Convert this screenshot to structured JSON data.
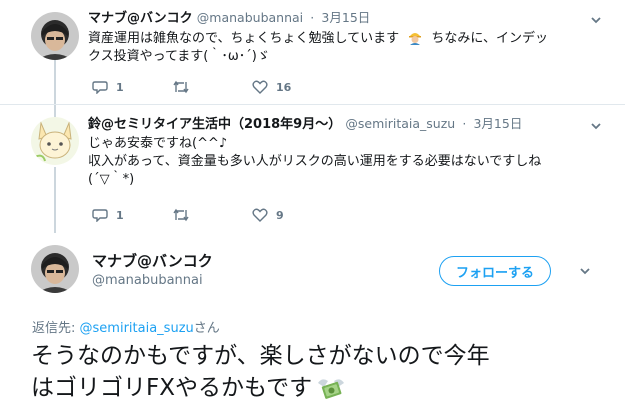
{
  "replies": [
    {
      "name": "マナブ@バンコク",
      "handle": "@manabubannai",
      "dot": "·",
      "date": "3月15日",
      "lines": [
        "資産運用は雑魚なので、ちょくちょく勉強しています",
        "ちなみに、インデッ",
        "クス投資やってます(｀･ω･´)ゞ"
      ],
      "reply_count": "1",
      "retweet_count": "",
      "like_count": "16"
    },
    {
      "name": "鈴@セミリタイア生活中（2018年9月～）",
      "handle": "@semiritaia_suzu",
      "dot": "·",
      "date": "3月15日",
      "lines": [
        "じゃあ安泰ですね(^^♪",
        "収入があって、資金量も多い人がリスクの高い運用をする必要はないですしね",
        "(´▽｀*)"
      ],
      "reply_count": "1",
      "retweet_count": "",
      "like_count": "9"
    }
  ],
  "main_tweet": {
    "name": "マナブ@バンコク",
    "handle": "@manabubannai",
    "follow_label": "フォローする",
    "replying_label": "返信先:",
    "replying_to": "@semiritaia_suzu",
    "replying_suffix": "さん",
    "lines": [
      "そうなのかもですが、楽しさがないので今年",
      "はゴリゴリFXやるかもです"
    ]
  },
  "colors": {
    "accent": "#1da1f2",
    "muted": "#657786",
    "text": "#14171a",
    "border": "#e1e8ed"
  },
  "icons": [
    "reply-icon",
    "retweet-icon",
    "heart-icon",
    "chevron-down-icon",
    "money-with-wings-icon",
    "construction-worker-icon"
  ]
}
